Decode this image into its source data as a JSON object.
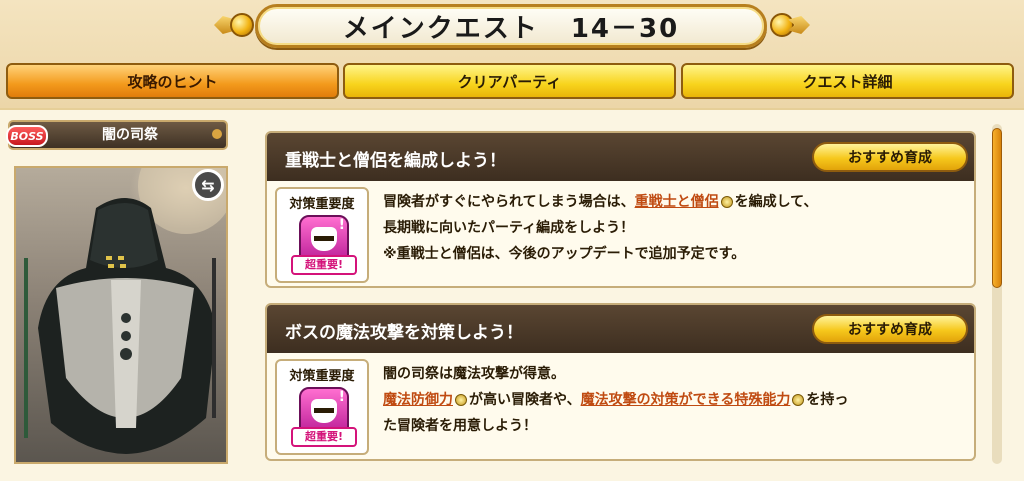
{
  "title": {
    "main": "メインクエスト",
    "number": "14－30"
  },
  "tabs": [
    {
      "label": "攻略のヒント",
      "active": true
    },
    {
      "label": "クリアパーティ",
      "active": false
    },
    {
      "label": "クエスト詳細",
      "active": false
    }
  ],
  "boss": {
    "badge": "BOSS",
    "name": "闇の司祭"
  },
  "hints": [
    {
      "title": "重戦士と僧侶を編成しよう！",
      "button": "おすすめ育成",
      "priority_label": "対策重要度",
      "priority_tag": "超重要!",
      "line1_pre": "冒険者がすぐにやられてしまう場合は、",
      "line1_hl": "重戦士と僧侶",
      "line1_post": "を編成して、",
      "line2": "長期戦に向いたパーティ編成をしよう！",
      "line3": "※重戦士と僧侶は、今後のアップデートで追加予定です。"
    },
    {
      "title": "ボスの魔法攻撃を対策しよう！",
      "button": "おすすめ育成",
      "priority_label": "対策重要度",
      "priority_tag": "超重要!",
      "line1": "闇の司祭は魔法攻撃が得意。",
      "line2_hl1": "魔法防御力",
      "line2_mid": "が高い冒険者や、",
      "line2_hl2": "魔法攻撃の対策ができる特殊能力",
      "line2_post": "を持っ",
      "line3": "た冒険者を用意しよう！"
    }
  ],
  "colors": {
    "tab_active": "#f39a1c",
    "tab_inactive": "#f8d41d",
    "card_header": "#4a3a2a",
    "highlight": "#c04b12",
    "priority_icon": "#d4137a"
  }
}
